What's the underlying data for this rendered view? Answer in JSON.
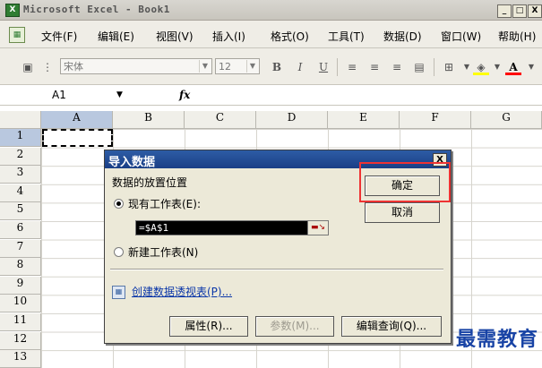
{
  "window": {
    "title": "Microsoft Excel - Book1",
    "app_icon": "excel-icon",
    "buttons": [
      "_",
      "□",
      "X"
    ]
  },
  "menubar": {
    "items": [
      "文件(F)",
      "编辑(E)",
      "视图(V)",
      "插入(I)",
      "格式(O)",
      "工具(T)",
      "数据(D)",
      "窗口(W)",
      "帮助(H)"
    ],
    "doc_controls": "_ 8"
  },
  "toolbar": {
    "font_name": "宋体",
    "font_size": "12",
    "bold": "B",
    "italic": "I",
    "underline": "U",
    "font_color_label": "A",
    "fill_color": "#ffff00",
    "font_color": "#ff0000"
  },
  "formula_bar": {
    "name_box": "A1",
    "fx": "fx"
  },
  "sheet": {
    "columns": [
      "A",
      "B",
      "C",
      "D",
      "E",
      "F",
      "G"
    ],
    "rows": [
      "1",
      "2",
      "3",
      "4",
      "5",
      "6",
      "7",
      "8",
      "9",
      "10",
      "11",
      "12",
      "13"
    ],
    "active_cell": "A1"
  },
  "dialog": {
    "title": "导入数据",
    "close": "X",
    "section_label": "数据的放置位置",
    "option_existing": "现有工作表(E):",
    "reference_value": "=$A$1",
    "option_new": "新建工作表(N)",
    "pivot_link": "创建数据透视表(P)...",
    "ok": "确定",
    "cancel": "取消",
    "properties": "属性(R)...",
    "parameters": "参数(M)...",
    "edit_query": "编辑查询(Q)..."
  },
  "watermark": "最需教育",
  "highlight_color": "#e33333"
}
